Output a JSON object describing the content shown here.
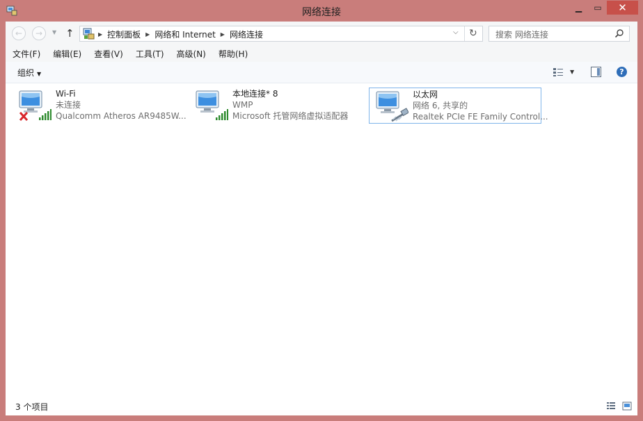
{
  "window": {
    "title": "网络连接"
  },
  "address": {
    "crumbs": [
      "控制面板",
      "网络和 Internet",
      "网络连接"
    ]
  },
  "search": {
    "placeholder": "搜索 网络连接"
  },
  "menu": [
    "文件(F)",
    "编辑(E)",
    "查看(V)",
    "工具(T)",
    "高级(N)",
    "帮助(H)"
  ],
  "command": {
    "organize": "组织"
  },
  "items": [
    {
      "name": "Wi-Fi",
      "status": "未连接",
      "device": "Qualcomm Atheros AR9485W...",
      "overlay": "red-x-icon",
      "signal": "signal-bars-icon"
    },
    {
      "name": "本地连接* 8",
      "status": "WMP",
      "device": "Microsoft 托管网络虚拟适配器",
      "overlay": "",
      "signal": "signal-bars-icon"
    },
    {
      "name": "以太网",
      "status": "网络  6, 共享的",
      "device": "Realtek PCIe FE Family Control...",
      "overlay": "",
      "signal": "ethernet-cable-icon"
    }
  ],
  "status": {
    "count": "3 个项目"
  },
  "colors": {
    "titlebar": "#c97d7b",
    "close": "#c7504a",
    "selection": "#7eb4ea",
    "help": "#2e6db8"
  }
}
